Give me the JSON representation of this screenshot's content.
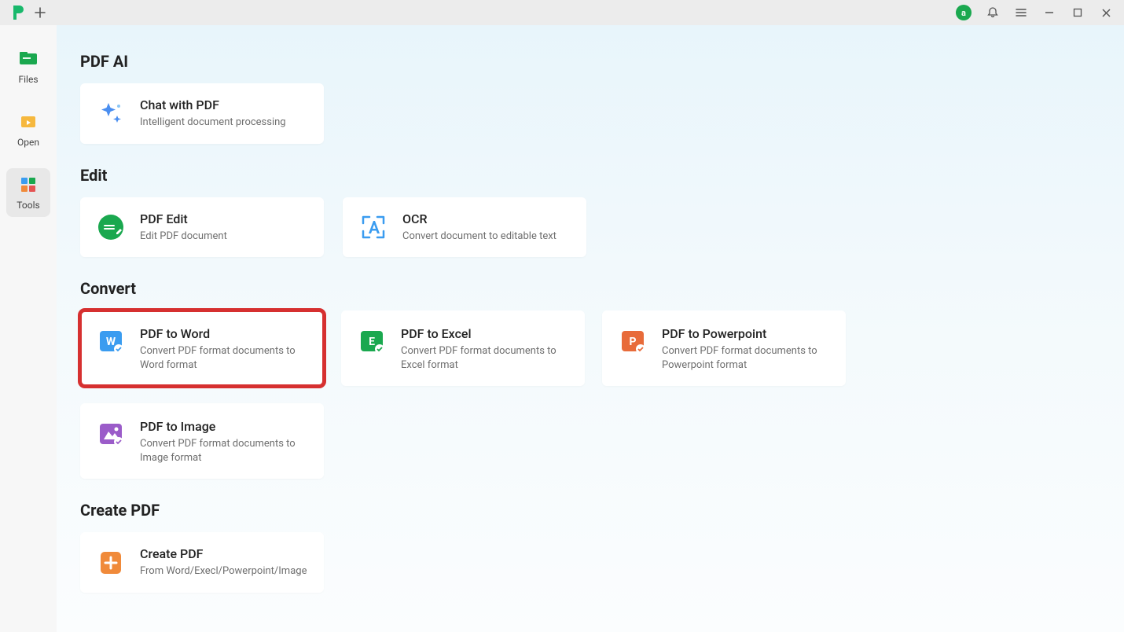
{
  "titlebar": {
    "avatar_letter": "a"
  },
  "sidebar": {
    "items": [
      {
        "label": "Files"
      },
      {
        "label": "Open"
      },
      {
        "label": "Tools"
      }
    ]
  },
  "sections": {
    "pdf_ai": {
      "heading": "PDF AI",
      "cards": [
        {
          "title": "Chat with PDF",
          "desc": "Intelligent document processing"
        }
      ]
    },
    "edit": {
      "heading": "Edit",
      "cards": [
        {
          "title": "PDF Edit",
          "desc": "Edit PDF document"
        },
        {
          "title": "OCR",
          "desc": "Convert document to editable text"
        }
      ]
    },
    "convert": {
      "heading": "Convert",
      "cards": [
        {
          "title": "PDF to Word",
          "desc": "Convert PDF format documents to Word format"
        },
        {
          "title": "PDF to Excel",
          "desc": "Convert PDF format documents to Excel format"
        },
        {
          "title": "PDF to Powerpoint",
          "desc": "Convert PDF format documents to Powerpoint format"
        },
        {
          "title": "PDF to Image",
          "desc": "Convert PDF format documents to Image format"
        }
      ]
    },
    "create": {
      "heading": "Create PDF",
      "cards": [
        {
          "title": "Create PDF",
          "desc": "From Word/Execl/Powerpoint/Image"
        }
      ]
    }
  }
}
